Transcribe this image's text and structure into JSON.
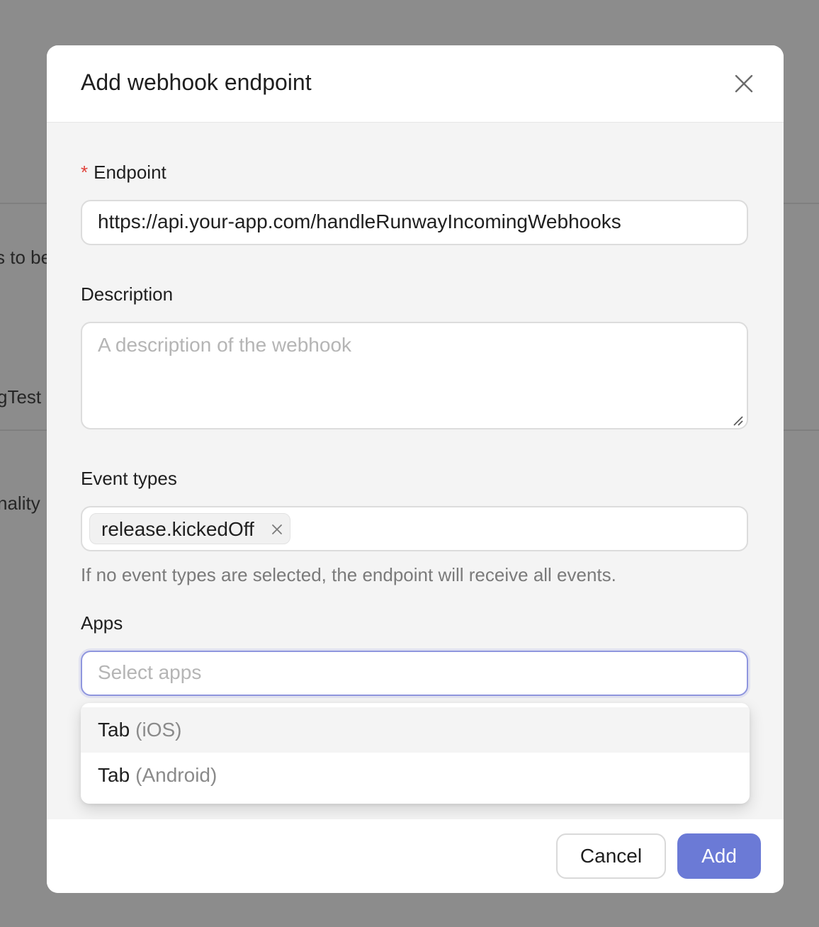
{
  "background": {
    "fragment_1": "s to be",
    "fragment_2": "gTest",
    "fragment_3": "nality"
  },
  "modal": {
    "title": "Add webhook endpoint",
    "close_icon": "close-icon",
    "endpoint": {
      "required_marker": "*",
      "label": "Endpoint",
      "value": "https://api.your-app.com/handleRunwayIncomingWebhooks"
    },
    "description": {
      "label": "Description",
      "placeholder": "A description of the webhook",
      "value": ""
    },
    "event_types": {
      "label": "Event types",
      "selected": [
        "release.kickedOff"
      ],
      "helper": "If no event types are selected, the endpoint will receive all events."
    },
    "apps": {
      "label": "Apps",
      "placeholder": "Select apps",
      "options": [
        {
          "name": "Tab",
          "platform": "(iOS)"
        },
        {
          "name": "Tab",
          "platform": "(Android)"
        }
      ]
    },
    "footer": {
      "cancel_label": "Cancel",
      "add_label": "Add"
    }
  },
  "colors": {
    "overlay": "#8c8c8c",
    "accent": "#6b7ad6",
    "required": "#e0413a",
    "focus_border": "#8f96de"
  }
}
